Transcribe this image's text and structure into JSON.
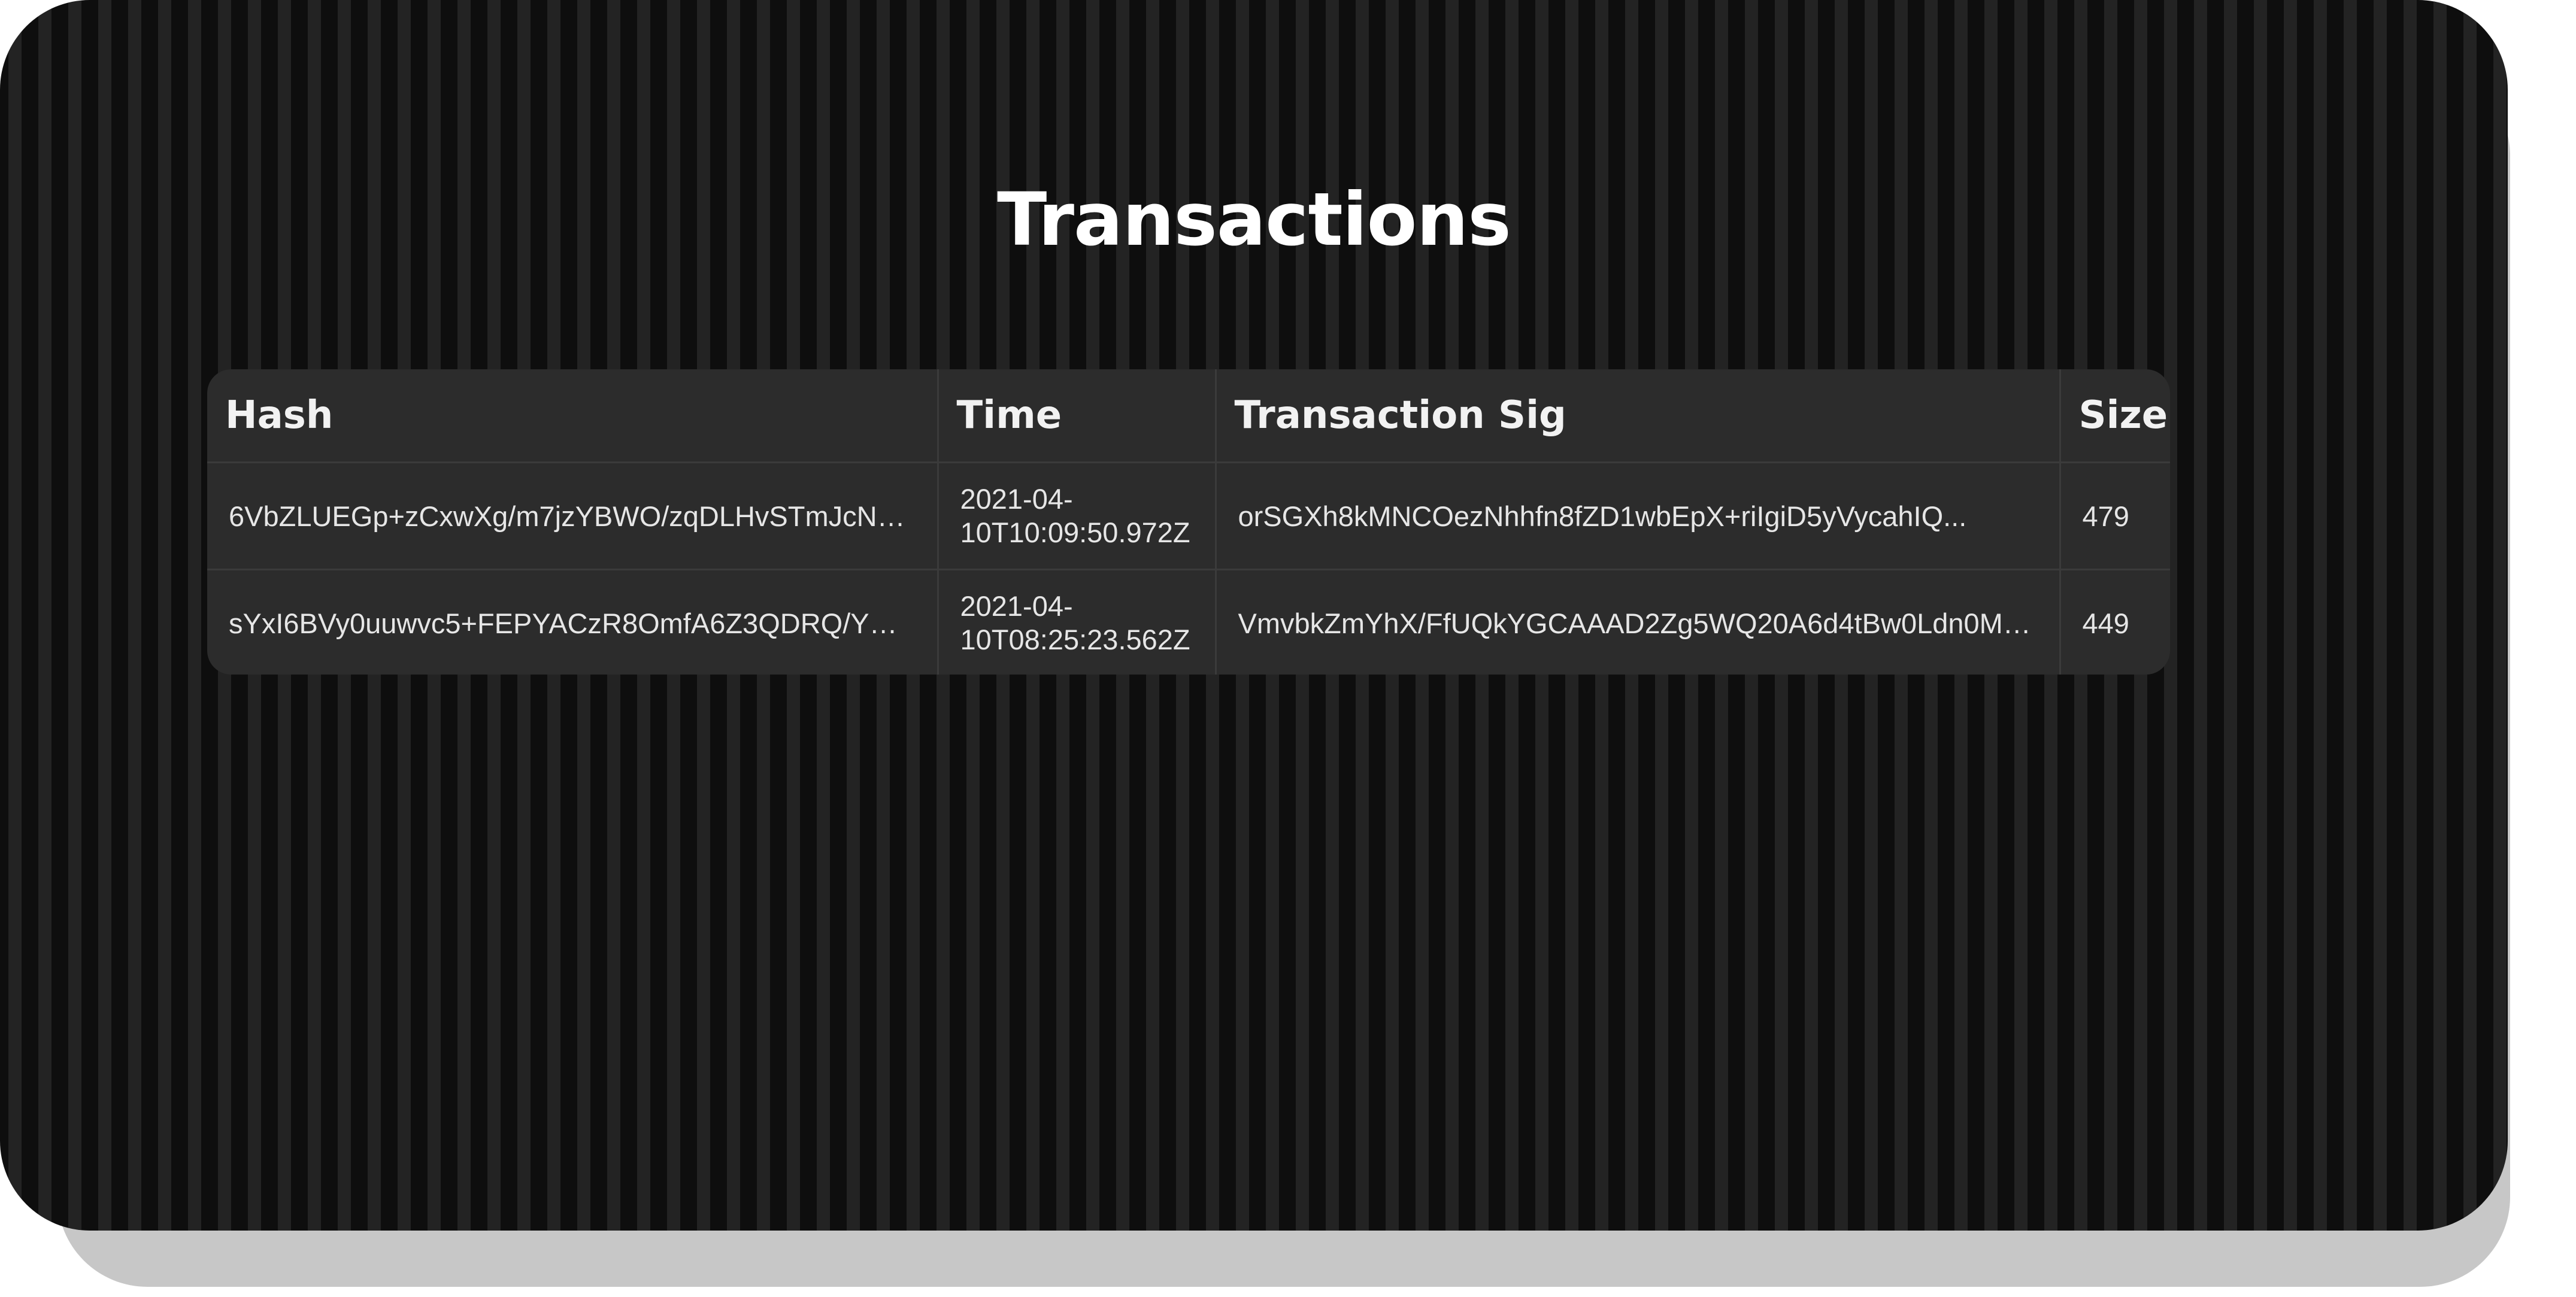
{
  "page": {
    "title": "Transactions"
  },
  "table": {
    "headers": {
      "hash": "Hash",
      "time": "Time",
      "sig": "Transaction Sig",
      "size": "Size"
    },
    "rows": [
      {
        "hash": "6VbZLUEGp+zCxwXg/m7jzYBWO/zqDLHvSTmJcNn+...",
        "time": "2021-04-10T10:09:50.972Z",
        "sig": "orSGXh8kMNCOezNhhfn8fZD1wbEpX+riIgiD5yVycahIQ...",
        "size": "479"
      },
      {
        "hash": "sYxI6BVy0uuwvc5+FEPYACzR8OmfA6Z3QDRQ/YHQ...",
        "time": "2021-04-10T08:25:23.562Z",
        "sig": "VmvbkZmYhX/FfUQkYGCAAAD2Zg5WQ20A6d4tBw0Ldn0Mc...",
        "size": "449"
      }
    ]
  },
  "colors": {
    "background": "#0e0e0e",
    "table": "#2c2c2c",
    "text": "#ffffff"
  }
}
